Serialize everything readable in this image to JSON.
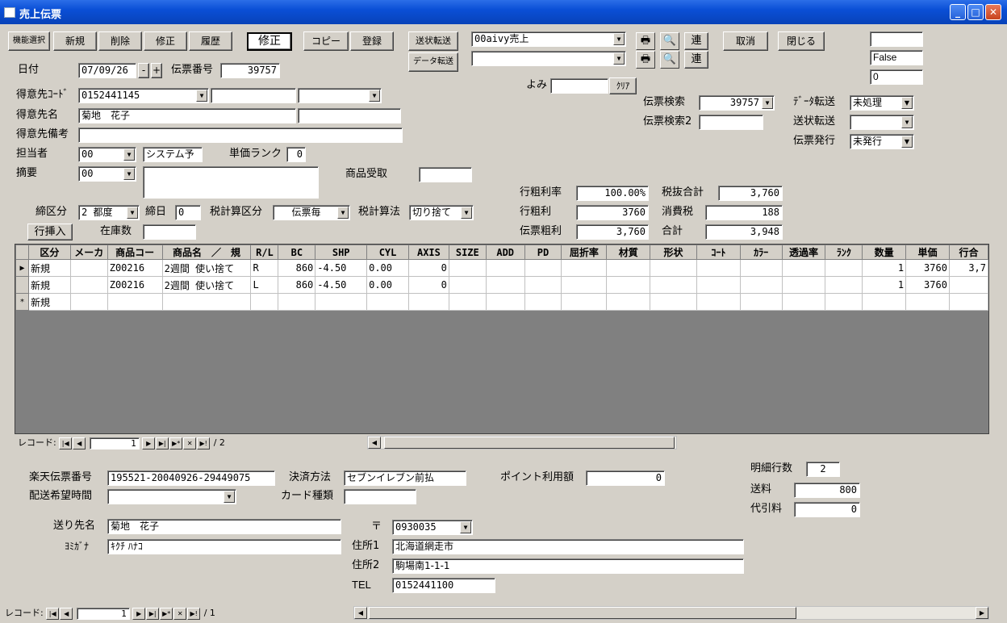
{
  "window": {
    "title": "売上伝票"
  },
  "toolbar": {
    "func_select": "機能選択",
    "new": "新規",
    "delete": "削除",
    "edit": "修正",
    "history": "履歴",
    "mode": "修正",
    "copy": "コピー",
    "register": "登録",
    "ship_transfer": "送状転送",
    "data_transfer": "データ転送",
    "cancel": "取消",
    "close": "閉じる",
    "link1": "連",
    "link2": "連"
  },
  "right_boxes": {
    "box1": "",
    "box2": "False",
    "box3": "0"
  },
  "report_select": {
    "value1": "00aivy売上",
    "value2": ""
  },
  "yomi": {
    "label": "よみ",
    "value": "",
    "clear": "ｸﾘｱ"
  },
  "header": {
    "date_label": "日付",
    "date": "07/09/26",
    "minus": "-",
    "plus": "+",
    "slip_no_label": "伝票番号",
    "slip_no": "39757",
    "cust_code_label": "得意先ｺｰﾄﾞ",
    "cust_code": "0152441145",
    "cust_sub1": "",
    "cust_sub2": "",
    "cust_name_label": "得意先名",
    "cust_name": "菊地　花子",
    "cust_name2": "",
    "cust_note_label": "得意先備考",
    "cust_note": "",
    "staff_label": "担当者",
    "staff_code": "00",
    "staff_name": "システム予",
    "price_rank_label": "単価ランク",
    "price_rank": "0",
    "summary_label": "摘要",
    "summary_code": "00",
    "summary_text": "",
    "product_recv_label": "商品受取",
    "product_recv": "",
    "close_type_label": "締区分",
    "close_type": "2 都度",
    "close_day_label": "締日",
    "close_day": "0",
    "tax_calc_type_label": "税計算区分",
    "tax_calc_type": "伝票毎",
    "tax_method_label": "税計算法",
    "tax_method": "切り捨て",
    "row_insert": "行挿入",
    "stock_label": "在庫数",
    "stock": ""
  },
  "search": {
    "slip_search_label": "伝票検索",
    "slip_search": "39757",
    "slip_search2_label": "伝票検索2",
    "slip_search2": "",
    "data_transfer_label": "ﾃﾞｰﾀ転送",
    "data_transfer": "未処理",
    "ship_transfer_label": "送状転送",
    "ship_transfer": "",
    "slip_issue_label": "伝票発行",
    "slip_issue": "未発行"
  },
  "totals": {
    "row_margin_rate_label": "行粗利率",
    "row_margin_rate": "100.00%",
    "row_margin_label": "行粗利",
    "row_margin": "3760",
    "slip_margin_label": "伝票粗利",
    "slip_margin": "3,760",
    "subtotal_label": "税抜合計",
    "subtotal": "3,760",
    "tax_label": "消費税",
    "tax": "188",
    "total_label": "合計",
    "total": "3,948"
  },
  "grid": {
    "columns": [
      "区分",
      "メーカ",
      "商品コー",
      "商品名　／　規",
      "R/L",
      "BC",
      "SHP",
      "CYL",
      "AXIS",
      "SIZE",
      "ADD",
      "PD",
      "屈折率",
      "材質",
      "形状",
      "ｺｰﾄ",
      "ｶﾗｰ",
      "透過率",
      "ﾗﾝｸ",
      "数量",
      "単価",
      "行合"
    ],
    "rows": [
      {
        "marker": "▶",
        "cells": [
          "新規",
          "",
          "Z00216",
          "2週間 使い捨て",
          "R",
          "860",
          "-4.50",
          "0.00",
          "0",
          "",
          "",
          "",
          "",
          "",
          "",
          "",
          "",
          "",
          "",
          "1",
          "3760",
          "3,7"
        ]
      },
      {
        "marker": "",
        "cells": [
          "新規",
          "",
          "Z00216",
          "2週間 使い捨て",
          "L",
          "860",
          "-4.50",
          "0.00",
          "0",
          "",
          "",
          "",
          "",
          "",
          "",
          "",
          "",
          "",
          "",
          "1",
          "3760",
          ""
        ]
      },
      {
        "marker": "*",
        "cells": [
          "新規",
          "",
          "",
          "",
          "",
          "",
          "",
          "",
          "",
          "",
          "",
          "",
          "",
          "",
          "",
          "",
          "",
          "",
          "",
          "",
          "",
          ""
        ]
      }
    ],
    "nav": {
      "label": "レコード:",
      "current": "1",
      "total": "/ 2"
    }
  },
  "footer": {
    "rakuten_label": "楽天伝票番号",
    "rakuten_no": "195521-20040926-29449075",
    "payment_label": "決済方法",
    "payment": "セブンイレブン前払",
    "point_label": "ポイント利用額",
    "point": "0",
    "detail_rows_label": "明細行数",
    "detail_rows": "2",
    "delivery_time_label": "配送希望時間",
    "delivery_time": "",
    "card_type_label": "カード種類",
    "card_type": "",
    "shipping_label": "送料",
    "shipping": "800",
    "cod_label": "代引料",
    "cod": "0",
    "recipient_label": "送り先名",
    "recipient": "菊地　花子",
    "kana_label": "ﾖﾐｶﾞﾅ",
    "kana": "ｷｸﾁ ﾊﾅｺ",
    "zip_label": "〒",
    "zip": "0930035",
    "addr1_label": "住所1",
    "addr1": "北海道網走市",
    "addr2_label": "住所2",
    "addr2": "駒場南1-1-1",
    "tel_label": "TEL",
    "tel": "0152441100"
  },
  "bottom_nav": {
    "label": "レコード:",
    "current": "1",
    "total": "/ 1"
  }
}
